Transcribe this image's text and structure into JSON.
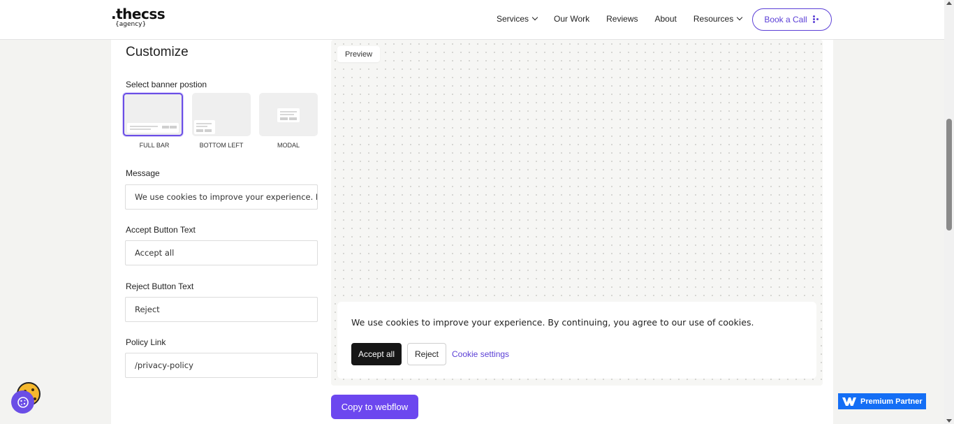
{
  "header": {
    "logo_text": ".thecss",
    "logo_sub": "{agency}",
    "nav": [
      {
        "label": "Services",
        "has_dropdown": true
      },
      {
        "label": "Our Work",
        "has_dropdown": false
      },
      {
        "label": "Reviews",
        "has_dropdown": false
      },
      {
        "label": "About",
        "has_dropdown": false
      },
      {
        "label": "Resources",
        "has_dropdown": true
      }
    ],
    "cta_label": "Book a Call"
  },
  "customize": {
    "title": "Customize",
    "position_label": "Select banner postion",
    "positions": [
      {
        "label": "FULL BAR",
        "selected": true
      },
      {
        "label": "BOTTOM LEFT",
        "selected": false
      },
      {
        "label": "MODAL",
        "selected": false
      }
    ],
    "message_label": "Message",
    "message_value": "We use cookies to improve your experience. B",
    "accept_label": "Accept Button Text",
    "accept_value": "Accept all",
    "reject_label": "Reject Button Text",
    "reject_value": "Reject",
    "policy_label": "Policy Link",
    "policy_value": "/privacy-policy"
  },
  "preview": {
    "tag": "Preview",
    "banner_message": "We use cookies to improve your experience. By continuing, you agree to our use of cookies.",
    "accept_button": "Accept all",
    "reject_button": "Reject",
    "settings_link": "Cookie settings"
  },
  "copy_button": "Copy to webflow",
  "badge": "Premium Partner",
  "colors": {
    "accent": "#6c47ef",
    "selected_border": "#6a4ee6",
    "badge_blue": "#146ef5",
    "accept_bg": "#161616"
  },
  "icons": [
    "chevron-down-icon",
    "dots-icon",
    "cookie-icon",
    "cookie-settings-icon",
    "webflow-logo-icon"
  ]
}
